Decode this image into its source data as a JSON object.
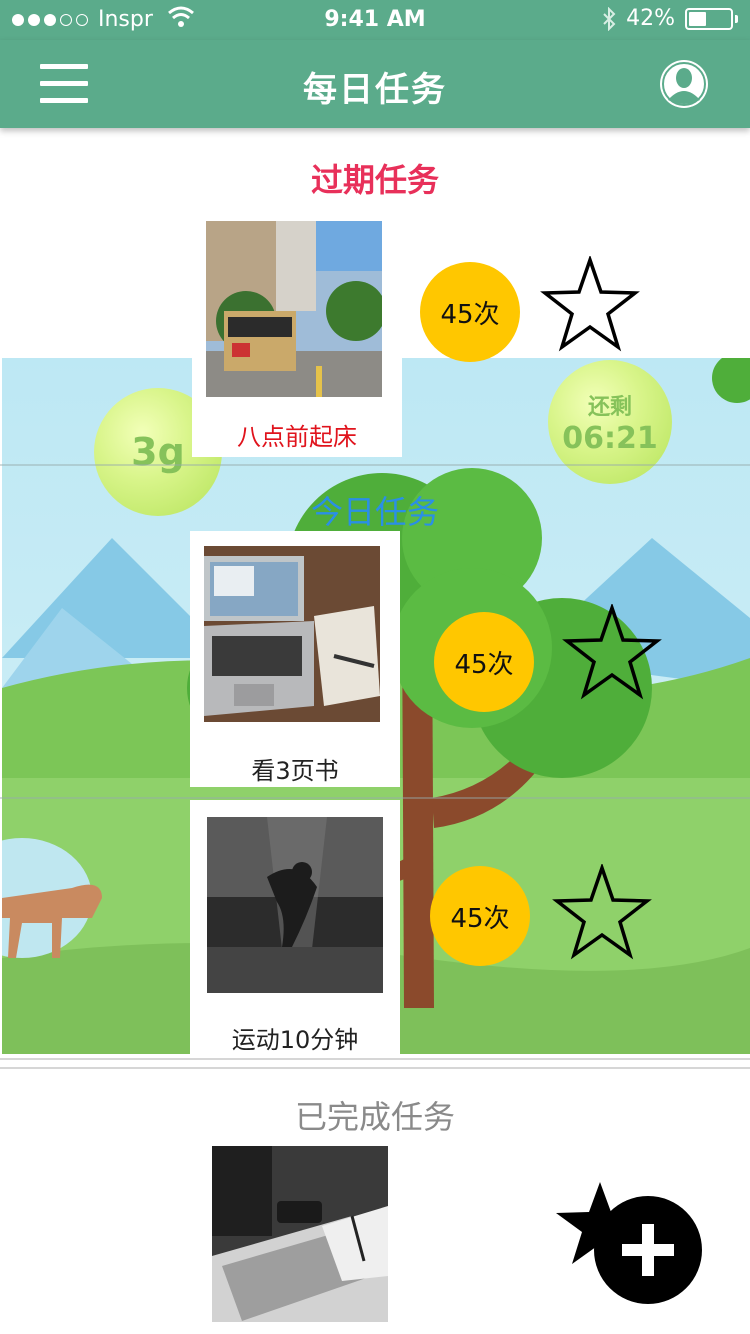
{
  "status_bar": {
    "carrier": "Inspr",
    "time": "9:41 AM",
    "battery": "42%",
    "battery_level": 0.42,
    "signal_bars_filled": 3,
    "signal_bars_total": 5
  },
  "nav": {
    "title": "每日任务",
    "menu_icon": "hamburger-menu-icon",
    "profile_icon": "user-profile-icon"
  },
  "sections": {
    "expired_title": "过期任务",
    "today_title": "今日任务",
    "done_title": "已完成任务"
  },
  "scene": {
    "left_bubble": "3g",
    "right_bubble_label": "还剩",
    "right_bubble_time": "06:21"
  },
  "tasks": {
    "expired": [
      {
        "label": "八点前起床",
        "count": "45次",
        "image": "cable-car-street-photo"
      }
    ],
    "today": [
      {
        "label": "看3页书",
        "count": "45次",
        "image": "laptop-notebook-photo"
      },
      {
        "label": "运动10分钟",
        "count": "45次",
        "image": "underwater-dancer-photo"
      }
    ],
    "done": [
      {
        "label": "",
        "image": "laptop-desk-bw-photo"
      }
    ]
  },
  "fab": {
    "icon": "add-star-icon"
  },
  "colors": {
    "primary": "#5bab8b",
    "expired_title": "#e8305a",
    "today_title": "#2a8fe6",
    "count_badge": "#ffc700",
    "done_title": "#8a8a8a"
  }
}
